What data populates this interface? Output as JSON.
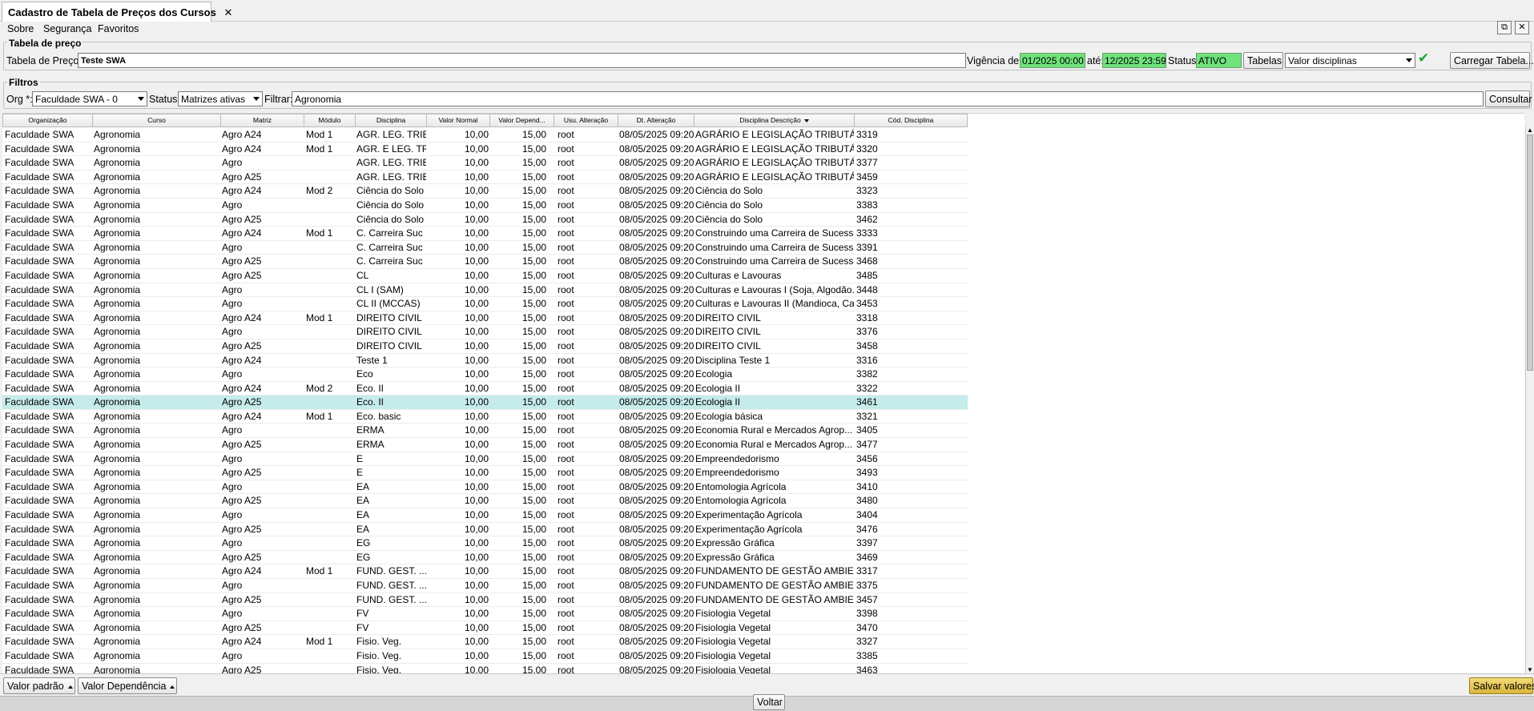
{
  "tab": {
    "title": "Cadastro de Tabela de Preços dos Cursos",
    "close": "✕"
  },
  "menu": {
    "sobre": "Sobre",
    "seguranca": "Segurança",
    "favoritos": "Favoritos"
  },
  "window_buttons": {
    "detach": "⧉",
    "close": "✕"
  },
  "tabela_preco": {
    "group_title": "Tabela de preço",
    "label": "Tabela de Preço:",
    "value": "Teste SWA",
    "vigencia_label": "Vigência de:",
    "vigencia_de": "01/2025 00:00",
    "ate_label": "até:",
    "vigencia_ate": "12/2025 23:59",
    "status_label": "Status:",
    "status_value": "ATIVO",
    "tabelas_button": "Tabelas",
    "valor_combo": "Valor disciplinas",
    "confirm_icon": "✔",
    "carregar_button": "Carregar Tabela..."
  },
  "filtros": {
    "group_title": "Filtros",
    "org_label": "Org *:",
    "org_value": "Faculdade SWA - 0",
    "status_label": "Status:",
    "status_value": "Matrizes ativas",
    "filtrar_label": "Filtrar:",
    "filtrar_value": "Agronomia",
    "consultar_button": "Consultar"
  },
  "table": {
    "columns": [
      "Organização",
      "Curso",
      "Matriz",
      "Módulo",
      "Disciplina",
      "Valor Normal",
      "Valor Depend...",
      "Usu. Alteração",
      "Dt. Alteração",
      "Disciplina Descrição",
      "Cód. Disciplina"
    ],
    "sorted_column_index": 9,
    "selected_row_index": 19,
    "rows": [
      [
        "Faculdade SWA",
        "Agronomia",
        "Agro A24",
        "Mod 1",
        "AGR. LEG. TRIB.",
        "10,00",
        "15,00",
        "root",
        "08/05/2025 09:20",
        "AGRÁRIO E LEGISLAÇÃO TRIBUTÁRI...",
        "3319"
      ],
      [
        "Faculdade SWA",
        "Agronomia",
        "Agro A24",
        "Mod 1",
        "AGR. E LEG. TR...",
        "10,00",
        "15,00",
        "root",
        "08/05/2025 09:20",
        "AGRÁRIO E LEGISLAÇÃO TRIBUTÁRI...",
        "3320"
      ],
      [
        "Faculdade SWA",
        "Agronomia",
        "Agro",
        "",
        "AGR. LEG. TRIB.",
        "10,00",
        "15,00",
        "root",
        "08/05/2025 09:20",
        "AGRÁRIO E LEGISLAÇÃO TRIBUTÁRI...",
        "3377"
      ],
      [
        "Faculdade SWA",
        "Agronomia",
        "Agro A25",
        "",
        "AGR. LEG. TRIB.",
        "10,00",
        "15,00",
        "root",
        "08/05/2025 09:20",
        "AGRÁRIO E LEGISLAÇÃO TRIBUTÁRI...",
        "3459"
      ],
      [
        "Faculdade SWA",
        "Agronomia",
        "Agro A24",
        "Mod 2",
        "Ciência do Solo",
        "10,00",
        "15,00",
        "root",
        "08/05/2025 09:20",
        "Ciência do Solo",
        "3323"
      ],
      [
        "Faculdade SWA",
        "Agronomia",
        "Agro",
        "",
        "Ciência do Solo",
        "10,00",
        "15,00",
        "root",
        "08/05/2025 09:20",
        "Ciência do Solo",
        "3383"
      ],
      [
        "Faculdade SWA",
        "Agronomia",
        "Agro A25",
        "",
        "Ciência do Solo",
        "10,00",
        "15,00",
        "root",
        "08/05/2025 09:20",
        "Ciência do Solo",
        "3462"
      ],
      [
        "Faculdade SWA",
        "Agronomia",
        "Agro A24",
        "Mod 1",
        "C. Carreira Suc",
        "10,00",
        "15,00",
        "root",
        "08/05/2025 09:20",
        "Construindo uma Carreira de Sucesso",
        "3333"
      ],
      [
        "Faculdade SWA",
        "Agronomia",
        "Agro",
        "",
        "C. Carreira Suc",
        "10,00",
        "15,00",
        "root",
        "08/05/2025 09:20",
        "Construindo uma Carreira de Sucesso",
        "3391"
      ],
      [
        "Faculdade SWA",
        "Agronomia",
        "Agro A25",
        "",
        "C. Carreira Suc",
        "10,00",
        "15,00",
        "root",
        "08/05/2025 09:20",
        "Construindo uma Carreira de Sucesso",
        "3468"
      ],
      [
        "Faculdade SWA",
        "Agronomia",
        "Agro A25",
        "",
        "CL",
        "10,00",
        "15,00",
        "root",
        "08/05/2025 09:20",
        "Culturas e Lavouras",
        "3485"
      ],
      [
        "Faculdade SWA",
        "Agronomia",
        "Agro",
        "",
        "CL I (SAM)",
        "10,00",
        "15,00",
        "root",
        "08/05/2025 09:20",
        "Culturas e Lavouras I (Soja, Algodão...",
        "3448"
      ],
      [
        "Faculdade SWA",
        "Agronomia",
        "Agro",
        "",
        "CL II (MCCAS)",
        "10,00",
        "15,00",
        "root",
        "08/05/2025 09:20",
        "Culturas e Lavouras II (Mandioca, Ca...",
        "3453"
      ],
      [
        "Faculdade SWA",
        "Agronomia",
        "Agro A24",
        "Mod 1",
        "DIREITO CIVIL",
        "10,00",
        "15,00",
        "root",
        "08/05/2025 09:20",
        "DIREITO CIVIL",
        "3318"
      ],
      [
        "Faculdade SWA",
        "Agronomia",
        "Agro",
        "",
        "DIREITO CIVIL",
        "10,00",
        "15,00",
        "root",
        "08/05/2025 09:20",
        "DIREITO CIVIL",
        "3376"
      ],
      [
        "Faculdade SWA",
        "Agronomia",
        "Agro A25",
        "",
        "DIREITO CIVIL",
        "10,00",
        "15,00",
        "root",
        "08/05/2025 09:20",
        "DIREITO CIVIL",
        "3458"
      ],
      [
        "Faculdade SWA",
        "Agronomia",
        "Agro A24",
        "",
        "Teste 1",
        "10,00",
        "15,00",
        "root",
        "08/05/2025 09:20",
        "Disciplina Teste 1",
        "3316"
      ],
      [
        "Faculdade SWA",
        "Agronomia",
        "Agro",
        "",
        "Eco",
        "10,00",
        "15,00",
        "root",
        "08/05/2025 09:20",
        "Ecologia",
        "3382"
      ],
      [
        "Faculdade SWA",
        "Agronomia",
        "Agro A24",
        "Mod 2",
        "Eco. II",
        "10,00",
        "15,00",
        "root",
        "08/05/2025 09:20",
        "Ecologia II",
        "3322"
      ],
      [
        "Faculdade SWA",
        "Agronomia",
        "Agro A25",
        "",
        "Eco. II",
        "10,00",
        "15,00",
        "root",
        "08/05/2025 09:20",
        "Ecologia II",
        "3461"
      ],
      [
        "Faculdade SWA",
        "Agronomia",
        "Agro A24",
        "Mod 1",
        "Eco. basic",
        "10,00",
        "15,00",
        "root",
        "08/05/2025 09:20",
        "Ecologia básica",
        "3321"
      ],
      [
        "Faculdade SWA",
        "Agronomia",
        "Agro",
        "",
        "ERMA",
        "10,00",
        "15,00",
        "root",
        "08/05/2025 09:20",
        "Economia Rural e Mercados Agrop...",
        "3405"
      ],
      [
        "Faculdade SWA",
        "Agronomia",
        "Agro A25",
        "",
        "ERMA",
        "10,00",
        "15,00",
        "root",
        "08/05/2025 09:20",
        "Economia Rural e Mercados Agrop...",
        "3477"
      ],
      [
        "Faculdade SWA",
        "Agronomia",
        "Agro",
        "",
        "E",
        "10,00",
        "15,00",
        "root",
        "08/05/2025 09:20",
        "Empreendedorismo",
        "3456"
      ],
      [
        "Faculdade SWA",
        "Agronomia",
        "Agro A25",
        "",
        "E",
        "10,00",
        "15,00",
        "root",
        "08/05/2025 09:20",
        "Empreendedorismo",
        "3493"
      ],
      [
        "Faculdade SWA",
        "Agronomia",
        "Agro",
        "",
        "EA",
        "10,00",
        "15,00",
        "root",
        "08/05/2025 09:20",
        "Entomologia Agrícola",
        "3410"
      ],
      [
        "Faculdade SWA",
        "Agronomia",
        "Agro A25",
        "",
        "EA",
        "10,00",
        "15,00",
        "root",
        "08/05/2025 09:20",
        "Entomologia Agrícola",
        "3480"
      ],
      [
        "Faculdade SWA",
        "Agronomia",
        "Agro",
        "",
        "EA",
        "10,00",
        "15,00",
        "root",
        "08/05/2025 09:20",
        "Experimentação Agrícola",
        "3404"
      ],
      [
        "Faculdade SWA",
        "Agronomia",
        "Agro A25",
        "",
        "EA",
        "10,00",
        "15,00",
        "root",
        "08/05/2025 09:20",
        "Experimentação Agrícola",
        "3476"
      ],
      [
        "Faculdade SWA",
        "Agronomia",
        "Agro",
        "",
        "EG",
        "10,00",
        "15,00",
        "root",
        "08/05/2025 09:20",
        "Expressão Gráfica",
        "3397"
      ],
      [
        "Faculdade SWA",
        "Agronomia",
        "Agro A25",
        "",
        "EG",
        "10,00",
        "15,00",
        "root",
        "08/05/2025 09:20",
        "Expressão Gráfica",
        "3469"
      ],
      [
        "Faculdade SWA",
        "Agronomia",
        "Agro A24",
        "Mod 1",
        "FUND. GEST. ...",
        "10,00",
        "15,00",
        "root",
        "08/05/2025 09:20",
        "FUNDAMENTO DE GESTÃO AMBIE...",
        "3317"
      ],
      [
        "Faculdade SWA",
        "Agronomia",
        "Agro",
        "",
        "FUND. GEST. ...",
        "10,00",
        "15,00",
        "root",
        "08/05/2025 09:20",
        "FUNDAMENTO DE GESTÃO AMBIE...",
        "3375"
      ],
      [
        "Faculdade SWA",
        "Agronomia",
        "Agro A25",
        "",
        "FUND. GEST. ...",
        "10,00",
        "15,00",
        "root",
        "08/05/2025 09:20",
        "FUNDAMENTO DE GESTÃO AMBIE...",
        "3457"
      ],
      [
        "Faculdade SWA",
        "Agronomia",
        "Agro",
        "",
        "FV",
        "10,00",
        "15,00",
        "root",
        "08/05/2025 09:20",
        "Fisiologia Vegetal",
        "3398"
      ],
      [
        "Faculdade SWA",
        "Agronomia",
        "Agro A25",
        "",
        "FV",
        "10,00",
        "15,00",
        "root",
        "08/05/2025 09:20",
        "Fisiologia Vegetal",
        "3470"
      ],
      [
        "Faculdade SWA",
        "Agronomia",
        "Agro A24",
        "Mod 1",
        "Fisio. Veg.",
        "10,00",
        "15,00",
        "root",
        "08/05/2025 09:20",
        "Fisiologia Vegetal",
        "3327"
      ],
      [
        "Faculdade SWA",
        "Agronomia",
        "Agro",
        "",
        "Fisio. Veg.",
        "10,00",
        "15,00",
        "root",
        "08/05/2025 09:20",
        "Fisiologia Vegetal",
        "3385"
      ],
      [
        "Faculdade SWA",
        "Agronomia",
        "Agro A25",
        "",
        "Fisio. Veg.",
        "10,00",
        "15,00",
        "root",
        "08/05/2025 09:20",
        "Fisiologia Vegetal",
        "3463"
      ]
    ]
  },
  "bottom": {
    "valor_padrao": "Valor padrão",
    "valor_dependencia": "Valor Dependência",
    "salvar": "Salvar valores",
    "voltar": "Voltar"
  },
  "colors": {
    "green_field": "#6fe37c",
    "selected_row": "#c6ebeb",
    "save_button": "#e3c24e",
    "check": "#1ca52f"
  }
}
